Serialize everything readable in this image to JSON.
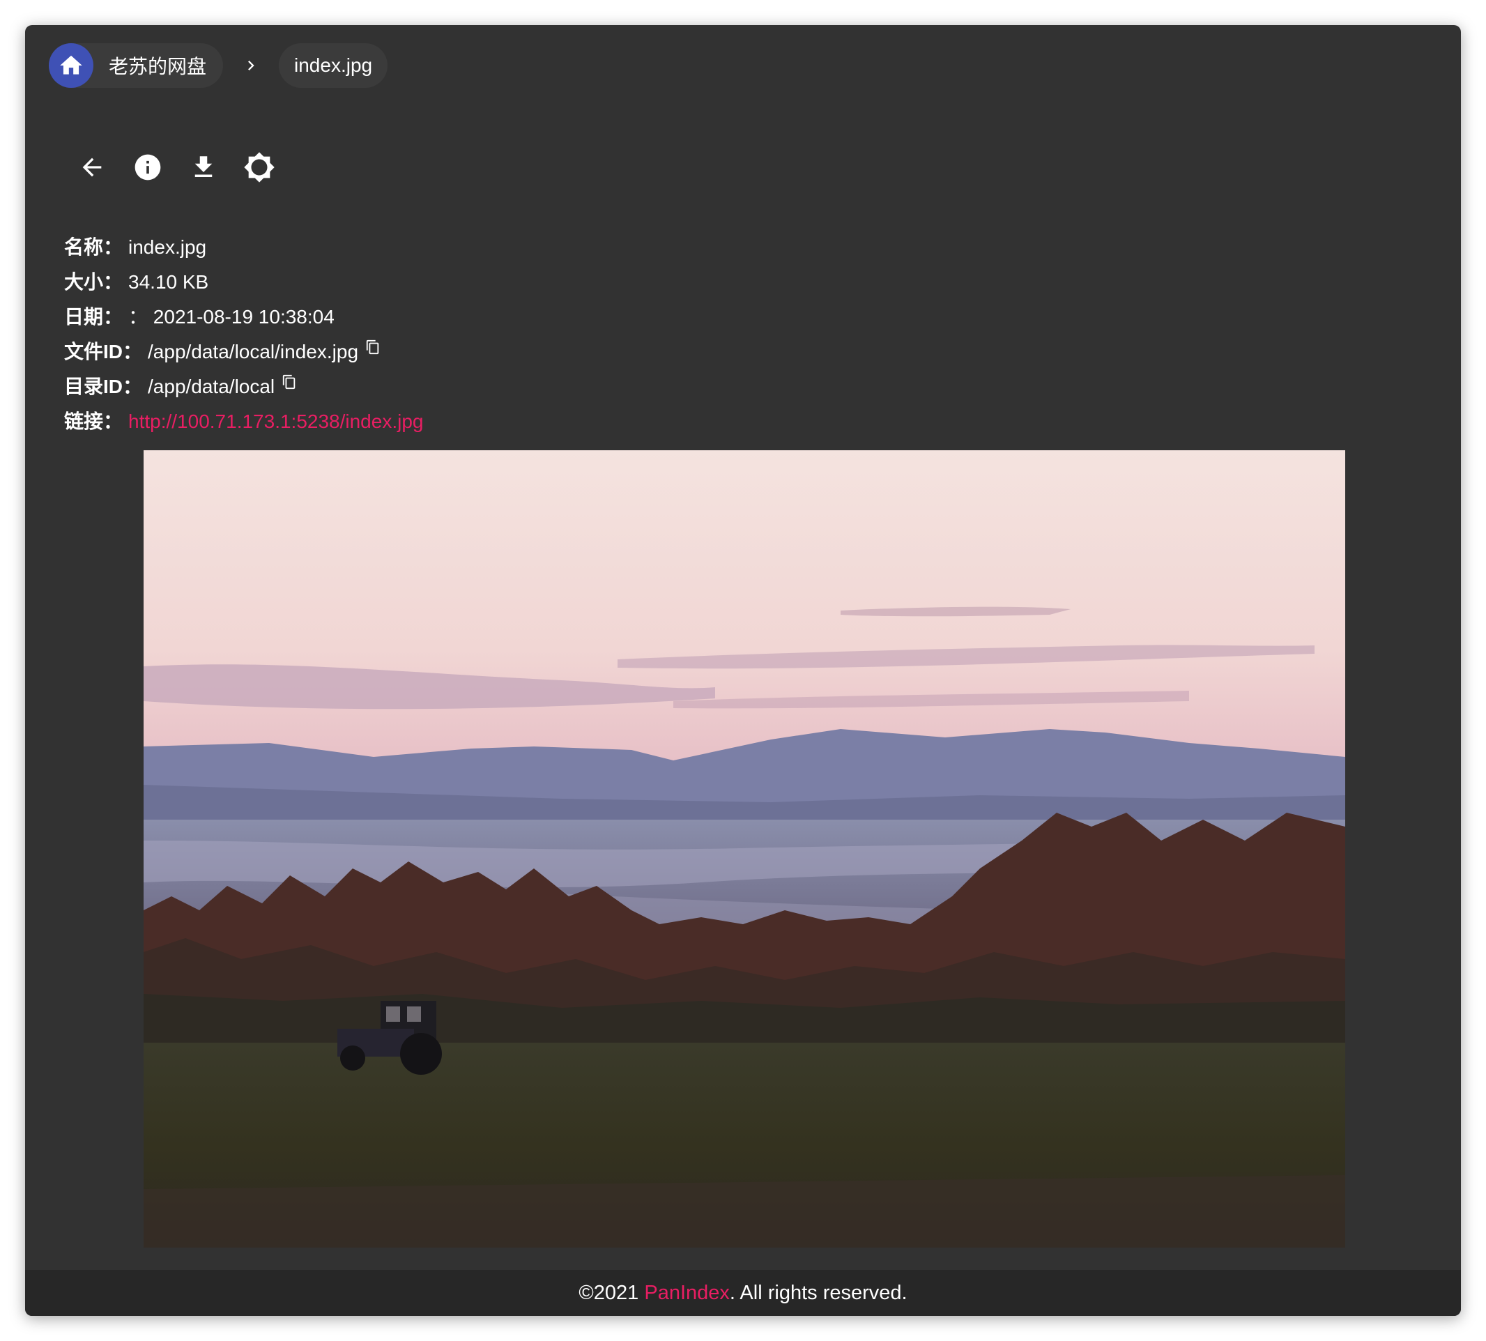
{
  "breadcrumb": {
    "home_label": "老苏的网盘",
    "file_label": "index.jpg",
    "home_icon": "home-icon",
    "separator_icon": "chevron-right-icon"
  },
  "toolbar": {
    "buttons": [
      {
        "icon": "arrow-back-icon"
      },
      {
        "icon": "info-icon"
      },
      {
        "icon": "download-icon"
      },
      {
        "icon": "brightness-icon"
      }
    ]
  },
  "info": {
    "name_label": "名称：",
    "name_value": "index.jpg",
    "size_label": "大小：",
    "size_value": "34.10 KB",
    "date_label": "日期：",
    "date_value": "： 2021-08-19 10:38:04",
    "file_id_label": "文件ID：",
    "file_id_value": "/app/data/local/index.jpg",
    "dir_id_label": "目录ID：",
    "dir_id_value": "/app/data/local",
    "link_label": "链接：",
    "link_value": "http://100.71.173.1:5238/index.jpg"
  },
  "footer": {
    "prefix": "©2021 ",
    "brand": "PanIndex",
    "suffix": ". All rights reserved."
  },
  "colors": {
    "window_bg": "#323232",
    "chip_bg": "#3b3b3b",
    "home_avatar": "#3f51b5",
    "link": "#e91e63",
    "footer_bg": "#272727"
  }
}
